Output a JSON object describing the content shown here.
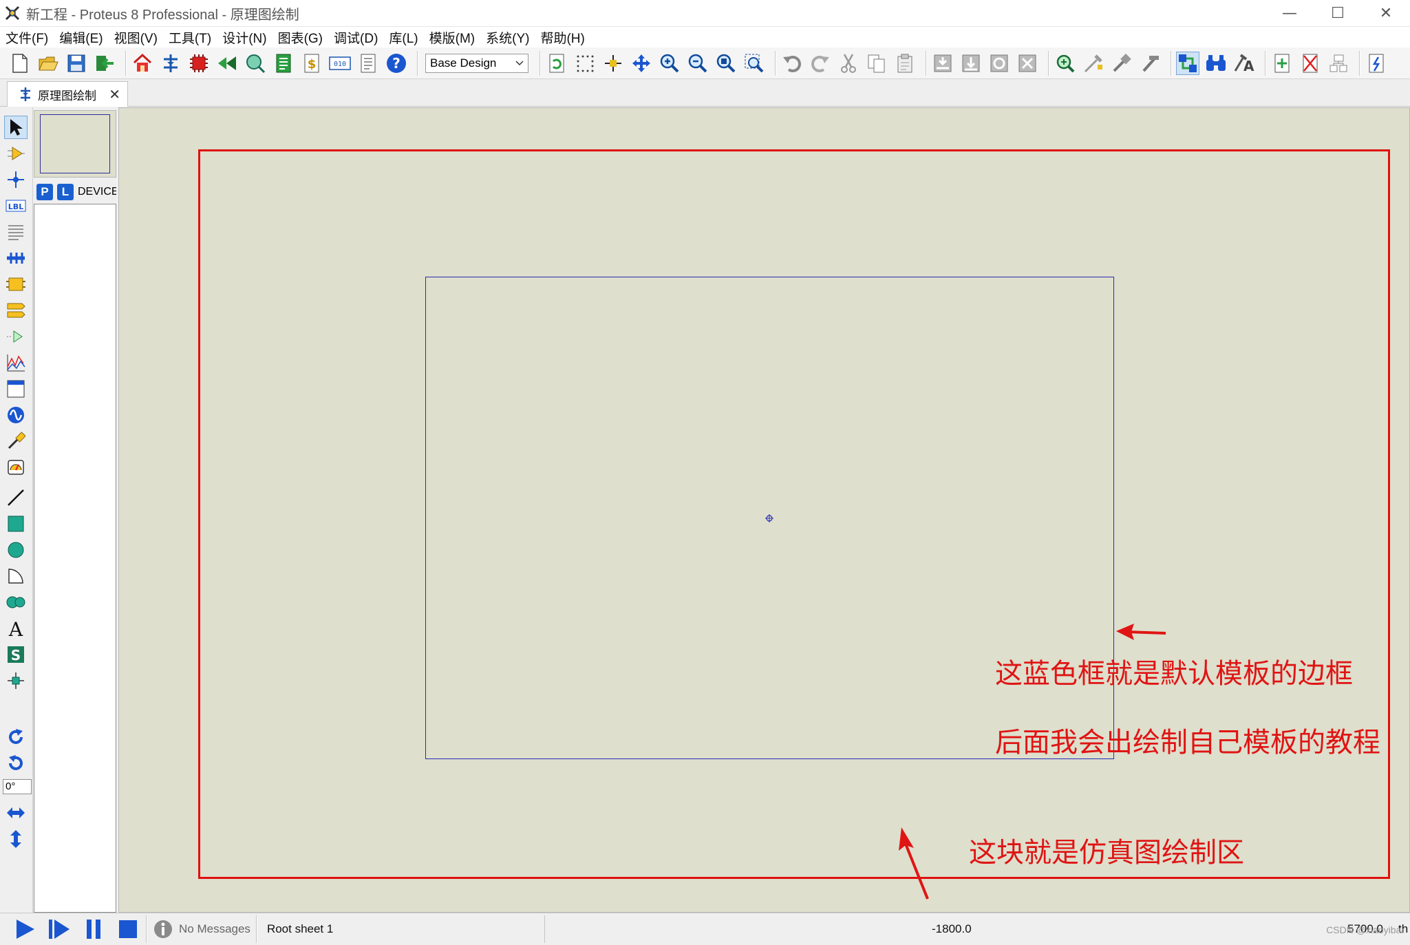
{
  "window": {
    "title": "新工程 - Proteus 8 Professional - 原理图绘制",
    "minimize": "—",
    "maximize": "☐",
    "close": "✕"
  },
  "menu": [
    "文件(F)",
    "编辑(E)",
    "视图(V)",
    "工具(T)",
    "设计(N)",
    "图表(G)",
    "调试(D)",
    "库(L)",
    "模版(M)",
    "系统(Y)",
    "帮助(H)"
  ],
  "toolbar": {
    "design_select": "Base Design",
    "icons_group1": [
      "new-file-icon",
      "open-folder-icon",
      "save-icon",
      "import-icon",
      "home-icon",
      "schematic-icon",
      "pcb-chip-icon",
      "gerber-icon",
      "3d-viewer-icon",
      "bom-icon",
      "dollar-icon",
      "binary-icon",
      "notes-icon",
      "help-icon"
    ],
    "icons_group2": [
      "refresh-icon",
      "grid-icon",
      "origin-icon",
      "pan-icon",
      "zoom-in-icon",
      "zoom-out-icon",
      "zoom-all-icon",
      "zoom-area-icon"
    ],
    "icons_group3": [
      "undo-icon",
      "redo-icon",
      "cut-icon",
      "copy-icon",
      "paste-icon",
      "block-copy-icon",
      "block-move-icon",
      "block-rotate-icon",
      "block-delete-icon",
      "pick-device-icon",
      "make-device-icon",
      "packaging-icon",
      "decompose-icon"
    ],
    "icons_group4": [
      "wire-autorouter-icon",
      "search-icon",
      "property-tool-icon",
      "new-sheet-icon",
      "delete-sheet-icon",
      "exit-parent-icon",
      "netlist-icon"
    ]
  },
  "tab": {
    "label": "原理图绘制",
    "close": "✕"
  },
  "left_tools": {
    "icons": [
      "selection-icon",
      "component-icon",
      "junction-icon",
      "wire-label-icon",
      "text-script-icon",
      "bus-icon",
      "subcircuit-icon",
      "terminal-icon",
      "pin-icon",
      "graph-icon",
      "tape-icon",
      "generator-icon",
      "probe-icon",
      "instrument-icon",
      "line-icon",
      "box-icon",
      "circle-icon",
      "arc-icon",
      "path-icon",
      "text-icon",
      "symbol-icon",
      "marker-icon",
      "rotate-cw-icon",
      "rotate-ccw-icon",
      "mirror-x-icon",
      "mirror-y-icon"
    ],
    "angle": "0°"
  },
  "device_selector": {
    "p_button": "P",
    "l_button": "L",
    "label": "DEVICES"
  },
  "canvas": {
    "annotation_blue": "这蓝色框就是默认模板的边框",
    "annotation_tutorial": "后面我会出绘制自己模板的教程",
    "annotation_area": "这块就是仿真图绘制区",
    "colors": {
      "background": "#dedfcc",
      "red_frame": "#e01010",
      "blue_frame": "#2a2ab4",
      "annotation": "#e01414"
    }
  },
  "statusbar": {
    "messages": "No Messages",
    "sheet": "Root sheet 1",
    "coord_x": "-1800.0",
    "coord_y": "5700.0",
    "unit": "th",
    "watermark": "CSDN @xiaoyibar"
  }
}
